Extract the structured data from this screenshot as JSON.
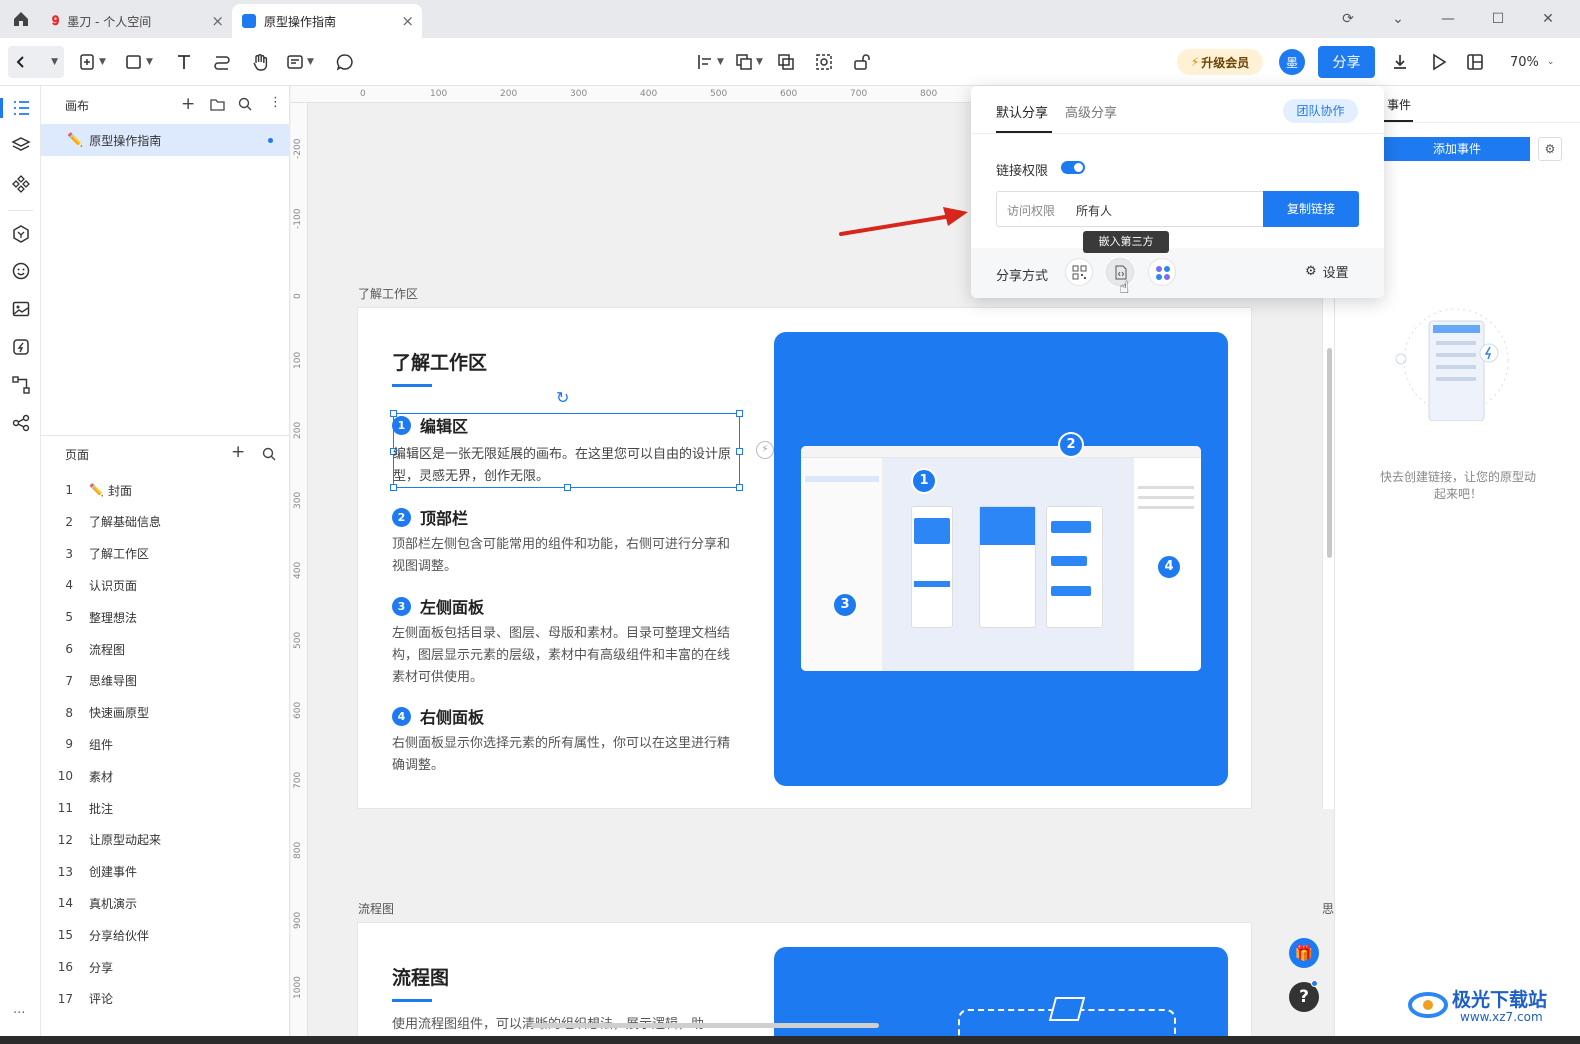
{
  "tabs": [
    {
      "label": "墨刀 - 个人空间"
    },
    {
      "label": "原型操作指南"
    }
  ],
  "toolbar": {
    "upgrade": "升级会员",
    "avatar": "墨",
    "share": "分享",
    "zoom": "70%"
  },
  "left_panel": {
    "canvas_header": "画布",
    "canvas_item": "原型操作指南",
    "pages_header": "页面",
    "pages": [
      {
        "n": "1",
        "label": "封面"
      },
      {
        "n": "2",
        "label": "了解基础信息"
      },
      {
        "n": "3",
        "label": "了解工作区"
      },
      {
        "n": "4",
        "label": "认识页面"
      },
      {
        "n": "5",
        "label": "整理想法"
      },
      {
        "n": "6",
        "label": "流程图"
      },
      {
        "n": "7",
        "label": "思维导图"
      },
      {
        "n": "8",
        "label": "快速画原型"
      },
      {
        "n": "9",
        "label": "组件"
      },
      {
        "n": "10",
        "label": "素材"
      },
      {
        "n": "11",
        "label": "批注"
      },
      {
        "n": "12",
        "label": "让原型动起来"
      },
      {
        "n": "13",
        "label": "创建事件"
      },
      {
        "n": "14",
        "label": "真机演示"
      },
      {
        "n": "15",
        "label": "分享给伙伴"
      },
      {
        "n": "16",
        "label": "分享"
      },
      {
        "n": "17",
        "label": "评论"
      }
    ]
  },
  "ruler": {
    "h": [
      "0",
      "100",
      "200",
      "300",
      "400",
      "500",
      "600",
      "700",
      "800"
    ],
    "v": [
      "-200",
      "-100",
      "0",
      "100",
      "200",
      "300",
      "400",
      "500",
      "600",
      "700",
      "800",
      "900",
      "1000"
    ]
  },
  "canvas": {
    "board1_label": "了解工作区",
    "board1": {
      "title": "了解工作区",
      "sections": [
        {
          "num": "1",
          "title": "编辑区",
          "text": "编辑区是一张无限延展的画布。在这里您可以自由的设计原型，灵感无界，创作无限。"
        },
        {
          "num": "2",
          "title": "顶部栏",
          "text": "顶部栏左侧包含可能常用的组件和功能，右侧可进行分享和视图调整。"
        },
        {
          "num": "3",
          "title": "左侧面板",
          "text": "左侧面板包括目录、图层、母版和素材。目录可整理文档结构，图层显示元素的层级，素材中有高级组件和丰富的在线素材可供使用。"
        },
        {
          "num": "4",
          "title": "右侧面板",
          "text": "右侧面板显示你选择元素的所有属性，你可以在这里进行精确调整。"
        }
      ],
      "markers": [
        "1",
        "2",
        "3",
        "4"
      ]
    },
    "board2_label": "流程图",
    "board2": {
      "title": "流程图",
      "text": "使用流程图组件，可以清晰的组织想法，展示逻辑，助"
    },
    "side_label": "思"
  },
  "right_panel": {
    "tab": "事件",
    "add_event": "添加事件",
    "empty": "快去创建链接，让您的原型动起来吧！"
  },
  "popover": {
    "tab_default": "默认分享",
    "tab_advanced": "高级分享",
    "team": "团队协作",
    "link_perm": "链接权限",
    "access_label": "访问权限",
    "access_value": "所有人",
    "copy": "复制链接",
    "tooltip": "嵌入第三方",
    "share_method": "分享方式",
    "settings": "设置"
  },
  "watermark": {
    "name": "极光下载站",
    "url": "www.xz7.com"
  },
  "colors": {
    "accent": "#1e7af0",
    "upgrade_bg": "#fff1d6",
    "arrow": "#d9261c"
  }
}
